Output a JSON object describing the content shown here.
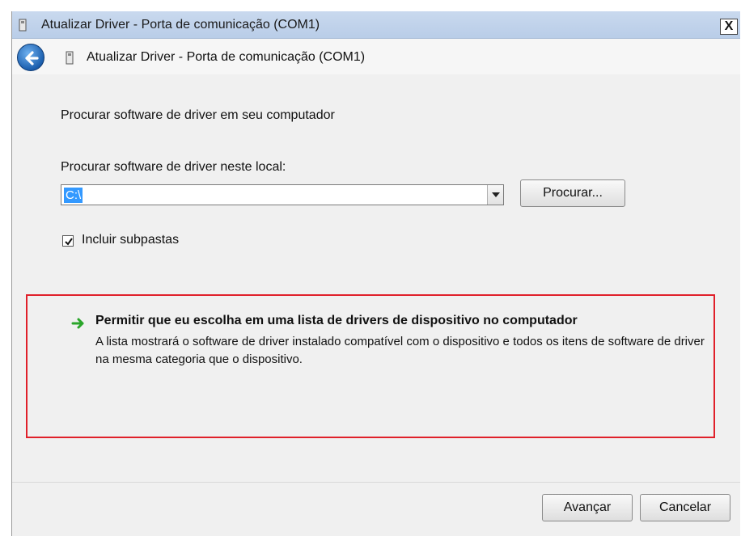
{
  "window": {
    "title": "Atualizar Driver -  Porta de comunicação (COM1)",
    "close_glyph": "X"
  },
  "nav": {
    "back_icon": "back-arrow-icon",
    "title": "Atualizar Driver -  Porta de comunicação (COM1)"
  },
  "content": {
    "heading": "Procurar software de driver em seu computador",
    "location_label": "Procurar software de driver neste local:",
    "location_value": "C:\\",
    "browse_button": "Procurar...",
    "include_subfolders_label": "Incluir subpastas",
    "include_subfolders_checked": true,
    "pick_option": {
      "icon": "green-arrow-icon",
      "title": "Permitir que eu escolha em uma lista de drivers de dispositivo no computador",
      "description": "A lista mostrará o software de driver instalado compatível com o dispositivo e todos os itens de software de driver na mesma categoria que o dispositivo."
    }
  },
  "footer": {
    "next_button": "Avançar",
    "cancel_button": "Cancelar"
  },
  "colors": {
    "highlight_border": "#e0202a",
    "selection": "#3399ff",
    "arrow_green": "#2aa52a"
  }
}
